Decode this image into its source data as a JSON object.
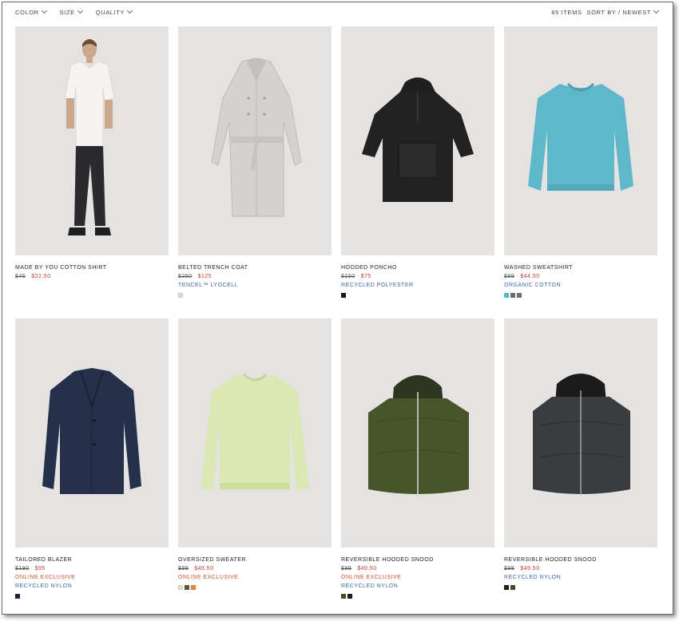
{
  "toolbar": {
    "filters": [
      "COLOR",
      "SIZE",
      "QUALITY"
    ],
    "item_count": "85 ITEMS",
    "sort_label": "SORT BY / NEWEST"
  },
  "products": [
    {
      "name": "MADE BY YOU COTTON SHIRT",
      "old_price": "$45",
      "price": "$22.50",
      "badge": "",
      "material": "",
      "swatches": []
    },
    {
      "name": "BELTED TRENCH COAT",
      "old_price": "$250",
      "price": "$125",
      "badge": "",
      "material": "TENCEL™ LYOCELL",
      "swatches": [
        "#d9d7d4"
      ]
    },
    {
      "name": "HOODED PONCHO",
      "old_price": "$150",
      "price": "$75",
      "badge": "",
      "material": "RECYCLED POLYESTER",
      "swatches": [
        "#161616"
      ]
    },
    {
      "name": "WASHED SWEATSHIRT",
      "old_price": "$89",
      "price": "$44.50",
      "badge": "",
      "material": "ORGANIC COTTON",
      "swatches": [
        "#52b7c9",
        "#6d6a5f",
        "#6e7276"
      ]
    },
    {
      "name": "TAILORED BLAZER",
      "old_price": "$190",
      "price": "$95",
      "badge": "ONLINE EXCLUSIVE",
      "material": "RECYCLED NYLON",
      "swatches": [
        "#1d2638"
      ]
    },
    {
      "name": "OVERSIZED SWEATER",
      "old_price": "$99",
      "price": "$49.50",
      "badge": "ONLINE EXCLUSIVE",
      "material": "",
      "swatches": [
        "#d8e6b5",
        "#595a3a",
        "#e5813a"
      ]
    },
    {
      "name": "REVERSIBLE HOODED SNOOD",
      "old_price": "$99",
      "price": "$49.50",
      "badge": "ONLINE EXCLUSIVE",
      "material": "RECYCLED NYLON",
      "swatches": [
        "#424a2b",
        "#1d1d1f"
      ]
    },
    {
      "name": "REVERSIBLE HOODED SNOOD",
      "old_price": "$99",
      "price": "$49.50",
      "badge": "",
      "material": "RECYCLED NYLON",
      "swatches": [
        "#1f2022",
        "#424a2b"
      ]
    }
  ]
}
